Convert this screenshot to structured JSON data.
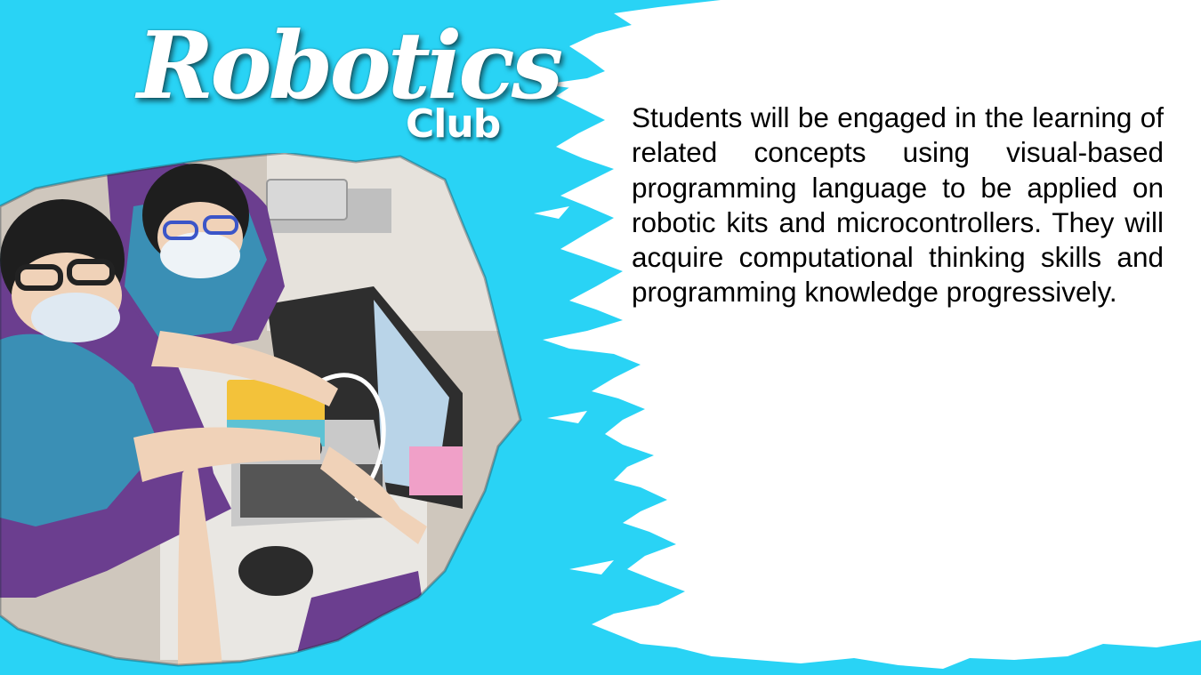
{
  "title": {
    "script": "Robotics",
    "suffix": "Club"
  },
  "description": "Students will be engaged in the learning of related concepts using visual-based programming language to be applied on robotic kits and microcontrollers. They will acquire computational thinking skills and programming knowledge progressively.",
  "colors": {
    "background_accent": "#29D3F5",
    "paper": "#ffffff",
    "text": "#000000"
  },
  "photo": {
    "subject": "students-with-robotics-kit-and-laptop"
  }
}
